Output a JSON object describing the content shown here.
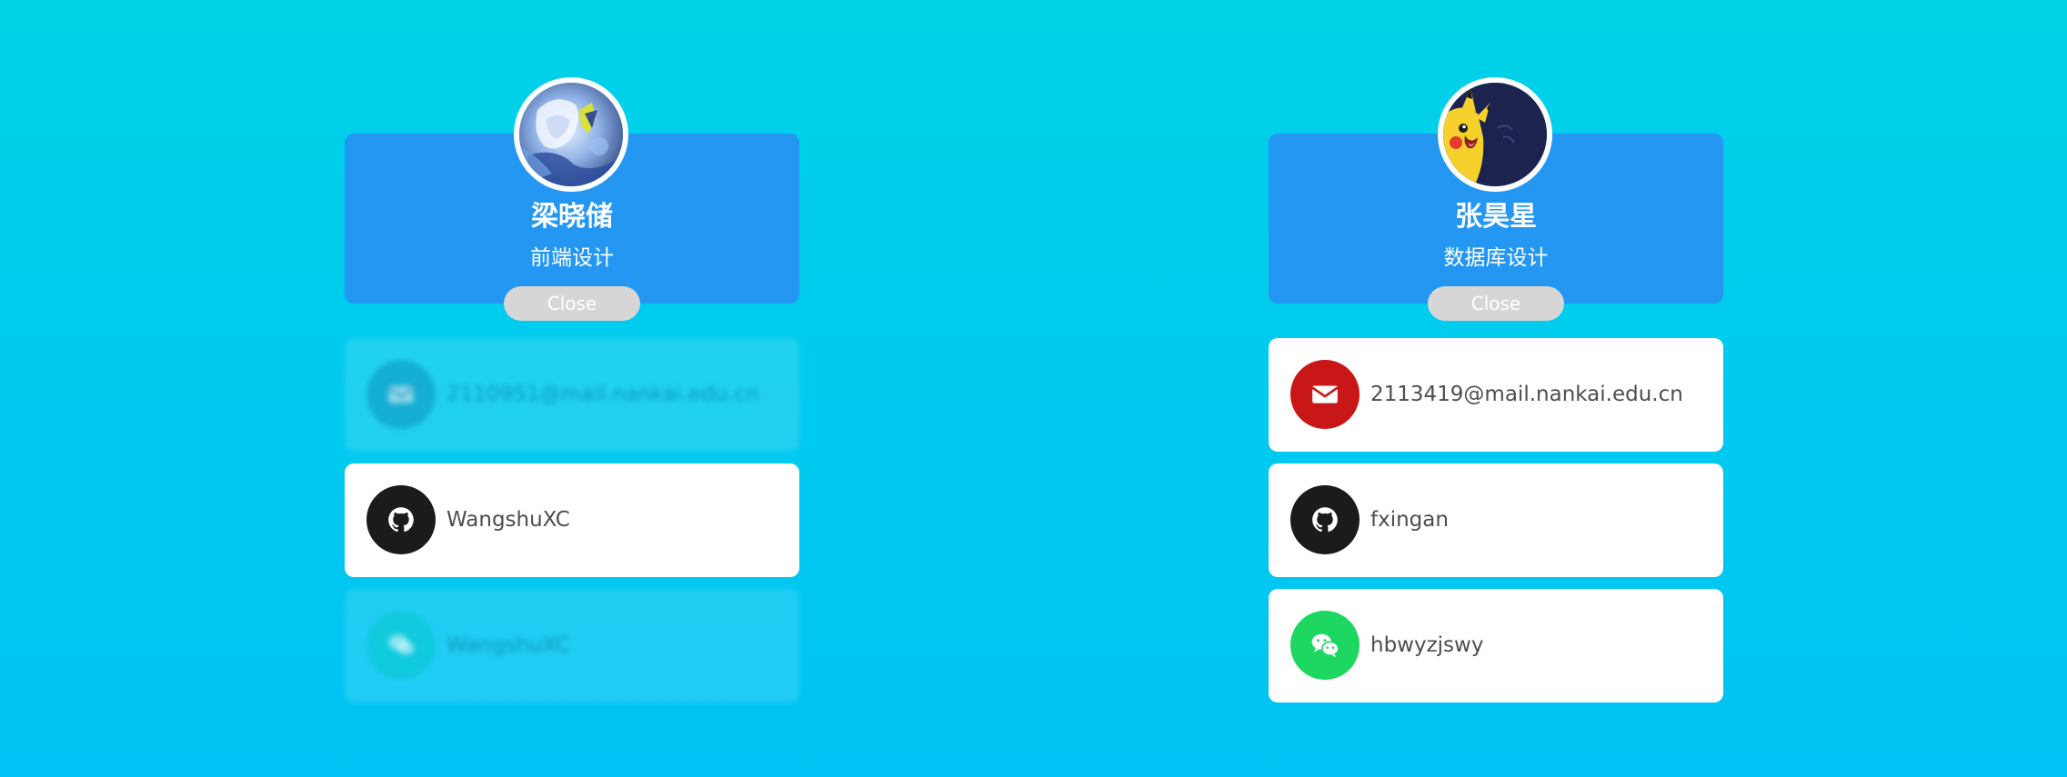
{
  "colors": {
    "background_top": "#00d2e8",
    "background_bottom": "#00c3f5",
    "header_card": "#2397f2",
    "close_button": "#d6d6d6",
    "email": "#c91717",
    "github": "#1b1b1b",
    "wechat": "#1ed760"
  },
  "profiles": [
    {
      "name": "梁晓储",
      "role": "前端设计",
      "close_label": "Close",
      "avatar_icon": "anime-avatar-icon",
      "contacts": [
        {
          "type": "email",
          "icon": "envelope-icon",
          "text": "2110951@mail.nankai.edu.cn",
          "state": "faded"
        },
        {
          "type": "github",
          "icon": "github-icon",
          "text": "WangshuXC",
          "state": "visible"
        },
        {
          "type": "wechat",
          "icon": "wechat-icon",
          "text": "WangshuXC",
          "state": "faded"
        }
      ]
    },
    {
      "name": "张昊星",
      "role": "数据库设计",
      "close_label": "Close",
      "avatar_icon": "pikachu-avatar-icon",
      "contacts": [
        {
          "type": "email",
          "icon": "envelope-icon",
          "text": "2113419@mail.nankai.edu.cn",
          "state": "visible"
        },
        {
          "type": "github",
          "icon": "github-icon",
          "text": "fxingan",
          "state": "visible"
        },
        {
          "type": "wechat",
          "icon": "wechat-icon",
          "text": "hbwyzjswy",
          "state": "visible"
        }
      ]
    }
  ]
}
